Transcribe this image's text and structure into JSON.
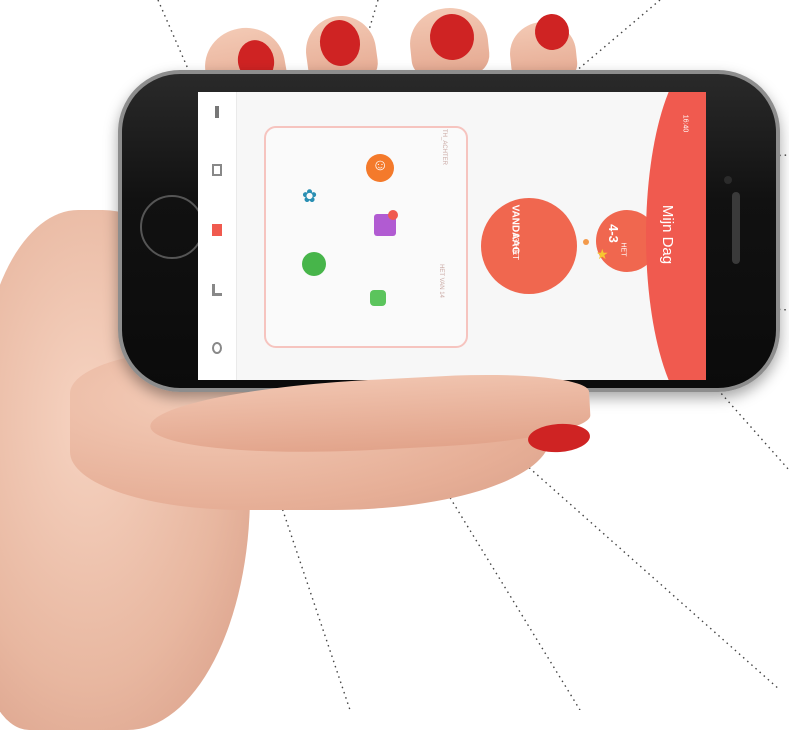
{
  "app": {
    "title": "Mijn Dag",
    "status_time": "16:40"
  },
  "today": {
    "label": "VANDAAG",
    "sub": "13 HET"
  },
  "het": {
    "value": "4-3",
    "label": "HET"
  },
  "panel": {
    "note_top": "TH_ACHTER",
    "note_bottom": "HET VAN 14"
  },
  "activities": [
    {
      "name": "smiley",
      "icon": "smiley-icon",
      "color": "#f47a2b"
    },
    {
      "name": "puzzle",
      "icon": "puzzle-icon",
      "color": "#b15bd2"
    },
    {
      "name": "people",
      "icon": "people-icon",
      "color": "#2a8fb3"
    },
    {
      "name": "apple",
      "icon": "apple-icon",
      "color": "#47b54a"
    },
    {
      "name": "chat",
      "icon": "chat-icon",
      "color": "#5bc45c"
    }
  ],
  "tabs": [
    {
      "icon": "person-icon"
    },
    {
      "icon": "calendar-icon"
    },
    {
      "icon": "flag-icon",
      "active": true
    },
    {
      "icon": "chart-icon"
    },
    {
      "icon": "settings-icon"
    }
  ],
  "colors": {
    "accent": "#f05a4f",
    "circle": "#f0674f",
    "nail": "#cf2323"
  }
}
